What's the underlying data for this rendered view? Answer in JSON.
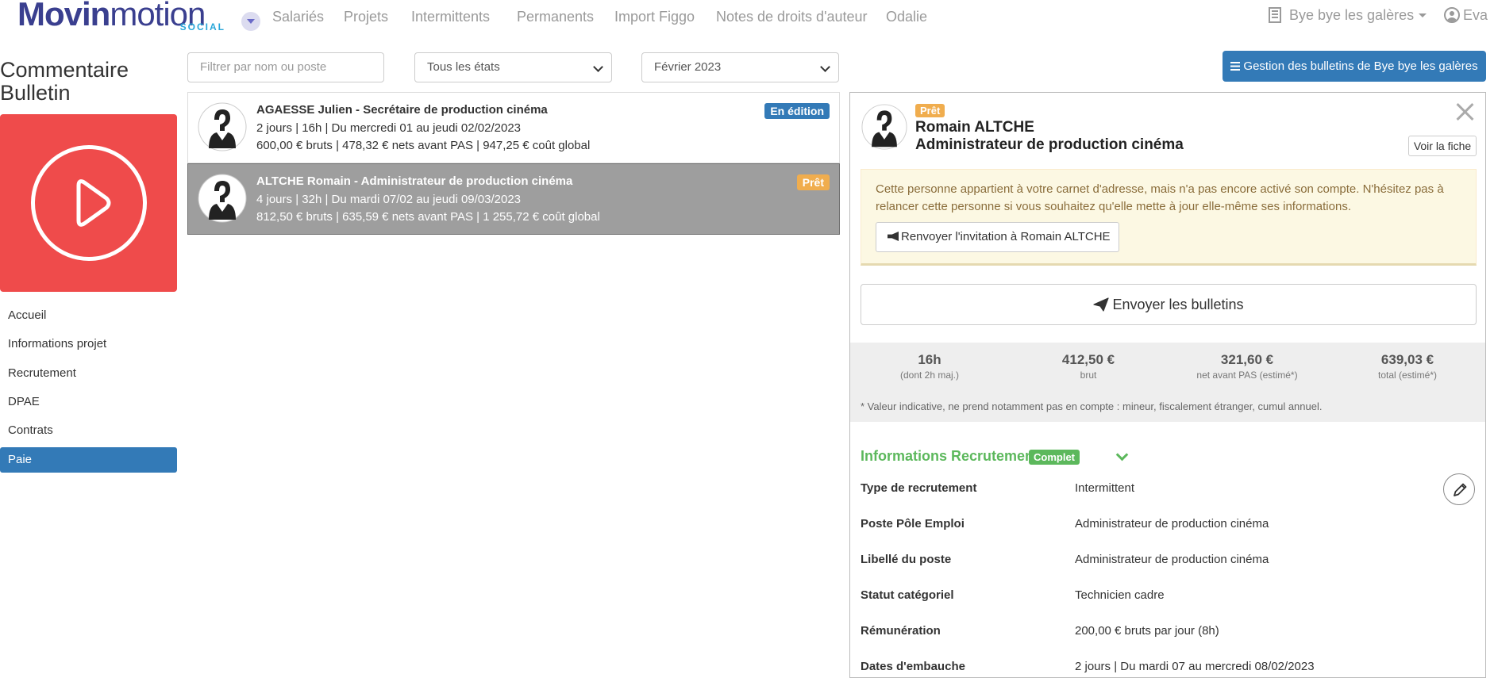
{
  "brand": {
    "name_bold": "Movin",
    "name_light": "motion",
    "sub": "SOCIAL",
    "color": "#3a3f8f",
    "accent": "#2aa7d9"
  },
  "nav": {
    "items": [
      "Salariés",
      "Projets",
      "Intermittents",
      "Permanents",
      "Import Figgo",
      "Notes de droits d'auteur",
      "Odalie"
    ],
    "org": "Bye bye les galères",
    "user": "Eva"
  },
  "sidebar": {
    "title": "Commentaire Bulletin",
    "items": [
      "Accueil",
      "Informations projet",
      "Recrutement",
      "DPAE",
      "Contrats",
      "Paie"
    ],
    "active": "Paie"
  },
  "filters": {
    "search_placeholder": "Filtrer par nom ou poste",
    "state": "Tous les états",
    "month": "Février 2023"
  },
  "manage_button": "Gestion des bulletins de Bye bye les galères",
  "employees": [
    {
      "name": "AGAESSE Julien - Secrétaire de production cinéma",
      "line2": "2 jours | 16h | Du mercredi 01 au jeudi 02/02/2023",
      "line3": "600,00 € bruts | 478,32 € nets avant PAS | 947,25 € coût global",
      "badge": "En édition"
    },
    {
      "name": "ALTCHE Romain - Administrateur de production cinéma",
      "line2": "4 jours | 32h | Du mardi 07/02 au jeudi 09/03/2023",
      "line3": "812,50 € bruts | 635,59 € nets avant PAS | 1 255,72 € coût global",
      "badge": "Prêt"
    }
  ],
  "detail": {
    "badge": "Prêt",
    "name": "Romain ALTCHE",
    "post": "Administrateur de production cinéma",
    "voir_fiche": "Voir la fiche",
    "alert": "Cette personne appartient à votre carnet d'adresse, mais n'a pas encore activé son compte. N'hésitez pas à relancer cette personne si vous souhaitez qu'elle mette à jour elle-même ses informations.",
    "resend": "Renvoyer l'invitation à Romain ALTCHE",
    "send": "Envoyer les bulletins",
    "stats": [
      {
        "value": "16h",
        "sub": "(dont 2h maj.)"
      },
      {
        "value": "412,50 €",
        "sub": "brut"
      },
      {
        "value": "321,60 €",
        "sub": "net avant PAS (estimé*)"
      },
      {
        "value": "639,03 €",
        "sub": "total (estimé*)"
      }
    ],
    "stats_note": "* Valeur indicative, ne prend notamment pas en compte : mineur, fiscalement étranger, cumul annuel.",
    "section_title": "Informations Recrutement",
    "section_badge": "Complet",
    "info": [
      {
        "label": "Type de recrutement",
        "value": "Intermittent"
      },
      {
        "label": "Poste Pôle Emploi",
        "value": "Administrateur de production cinéma"
      },
      {
        "label": "Libellé du poste",
        "value": "Administrateur de production cinéma"
      },
      {
        "label": "Statut catégoriel",
        "value": "Technicien cadre"
      },
      {
        "label": "Rémunération",
        "value": "200,00 € bruts par jour (8h)"
      },
      {
        "label": "Dates d'embauche",
        "value": "2 jours | Du mardi 07 au mercredi 08/02/2023"
      }
    ]
  },
  "colors": {
    "primary": "#337ab7",
    "warning": "#f0ad4e",
    "success": "#5cb85c",
    "video_red": "#ef4b4b"
  }
}
